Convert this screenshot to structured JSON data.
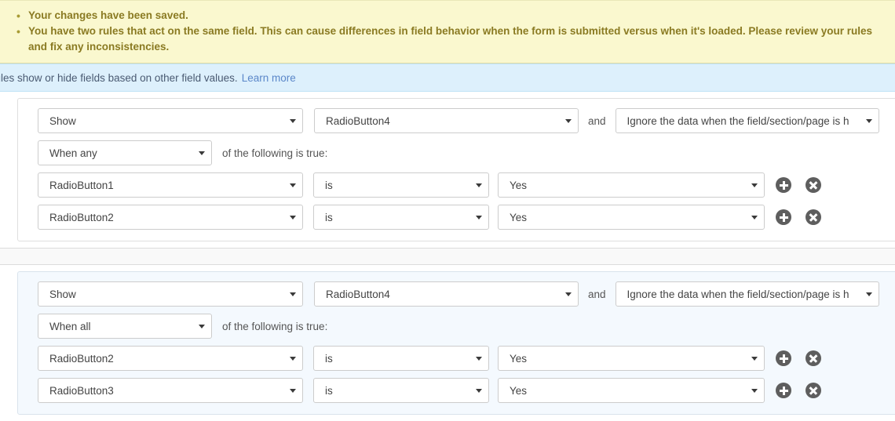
{
  "warning_banner": {
    "messages": [
      "Your changes have been saved.",
      "You have two rules that act on the same field. This can cause differences in field behavior when the form is submitted versus when it's loaded. Please review your rules and fix any inconsistencies."
    ]
  },
  "info_banner": {
    "text": "rules show or hide fields based on other field values.",
    "link_label": "Learn more"
  },
  "labels": {
    "and": "and",
    "of_the_following": "of the following is true:"
  },
  "colors": {
    "warning_bg": "#faf8cf",
    "warning_text": "#8a7a22",
    "info_bg": "#ddf0fc",
    "info_link": "#5b87c9",
    "icon_button": "#5e5e5e",
    "tinted_block_bg": "#f4f9fe"
  },
  "rules": [
    {
      "tinted": false,
      "action": "Show",
      "target": "RadioButton4",
      "behavior": "Ignore the data when the field/section/page is h",
      "logic": "When any",
      "conditions": [
        {
          "field": "RadioButton1",
          "operator": "is",
          "value": "Yes"
        },
        {
          "field": "RadioButton2",
          "operator": "is",
          "value": "Yes"
        }
      ]
    },
    {
      "tinted": true,
      "action": "Show",
      "target": "RadioButton4",
      "behavior": "Ignore the data when the field/section/page is h",
      "logic": "When all",
      "conditions": [
        {
          "field": "RadioButton2",
          "operator": "is",
          "value": "Yes"
        },
        {
          "field": "RadioButton3",
          "operator": "is",
          "value": "Yes"
        }
      ]
    }
  ]
}
